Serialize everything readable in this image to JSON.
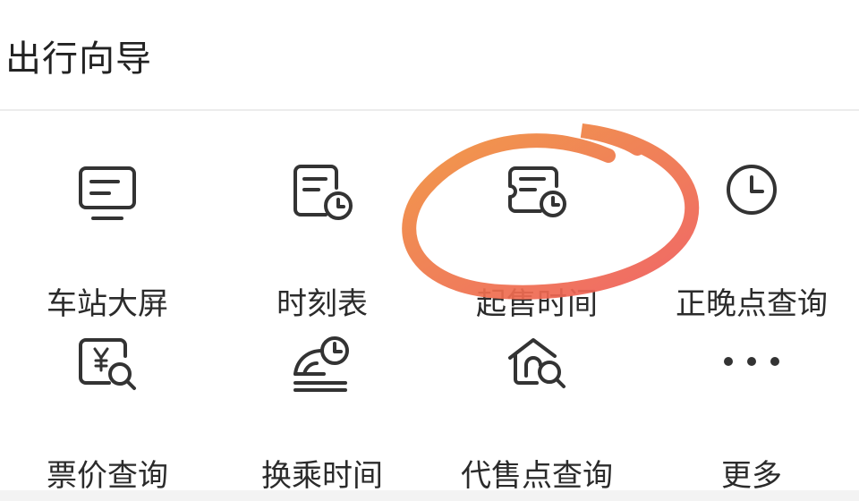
{
  "section": {
    "title": "出行向导"
  },
  "colors": {
    "icon_stroke": "#333333",
    "annotation_start": "#f0923a",
    "annotation_end": "#ee5a5a"
  },
  "items": [
    {
      "label": "车站大屏",
      "icon": "monitor-icon"
    },
    {
      "label": "时刻表",
      "icon": "timetable-clock-icon"
    },
    {
      "label": "起售时间",
      "icon": "ticket-clock-icon"
    },
    {
      "label": "正晚点查询",
      "icon": "clock-icon"
    },
    {
      "label": "票价查询",
      "icon": "price-search-icon"
    },
    {
      "label": "换乘时间",
      "icon": "train-clock-icon"
    },
    {
      "label": "代售点查询",
      "icon": "house-search-icon"
    },
    {
      "label": "更多",
      "icon": "more-dots-icon"
    }
  ]
}
